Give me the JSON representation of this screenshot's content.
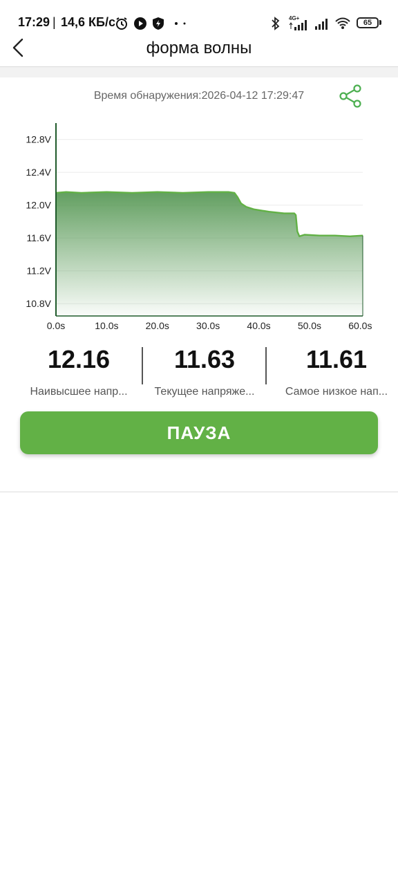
{
  "status_bar": {
    "time": "17:29",
    "separator": "|",
    "net_speed": "14,6 КБ/с",
    "network_type": "4G+",
    "battery": "65",
    "icons": [
      "alarm-icon",
      "play-icon",
      "security-shield-icon",
      "bluetooth-icon",
      "signal-icon",
      "wifi-icon"
    ]
  },
  "header": {
    "title": "форма волны",
    "back_icon": "chevron-left-icon"
  },
  "detection": {
    "time_text": "Время обнаружения:2026-04-12 17:29:47",
    "share_icon": "share-icon"
  },
  "chart_data": {
    "type": "area",
    "title": "",
    "xlabel": "",
    "ylabel": "",
    "y_ticks": [
      "12.8V",
      "12.4V",
      "12.0V",
      "11.6V",
      "11.2V",
      "10.8V"
    ],
    "y_tick_values": [
      12.8,
      12.4,
      12.0,
      11.6,
      11.2,
      10.8
    ],
    "x_ticks": [
      "0.0s",
      "10.0s",
      "20.0s",
      "30.0s",
      "40.0s",
      "50.0s",
      "60.0s"
    ],
    "x_tick_values": [
      0,
      10,
      20,
      30,
      40,
      50,
      60
    ],
    "xlim": [
      0,
      60.5
    ],
    "ylim": [
      10.65,
      13.0
    ],
    "grid": true,
    "color": "#62b146",
    "series": [
      {
        "x": [
          0,
          2,
          5,
          10,
          15,
          20,
          25,
          30,
          34,
          35.2,
          35.8,
          36.5,
          37.5,
          39,
          42,
          45,
          47,
          47.3,
          47.6,
          48,
          49,
          52,
          55,
          58,
          60.5
        ],
        "values": [
          12.15,
          12.16,
          12.15,
          12.16,
          12.15,
          12.16,
          12.15,
          12.16,
          12.16,
          12.15,
          12.1,
          12.02,
          11.98,
          11.95,
          11.92,
          11.9,
          11.9,
          11.88,
          11.68,
          11.62,
          11.64,
          11.63,
          11.63,
          11.62,
          11.63
        ]
      }
    ]
  },
  "stats": [
    {
      "value": "12.16",
      "label": "Наивысшее напр..."
    },
    {
      "value": "11.63",
      "label": "Текущее напряже..."
    },
    {
      "value": "11.61",
      "label": "Самое низкое нап..."
    }
  ],
  "pause_button": {
    "label": "ПАУЗА",
    "color": "#62b146"
  }
}
